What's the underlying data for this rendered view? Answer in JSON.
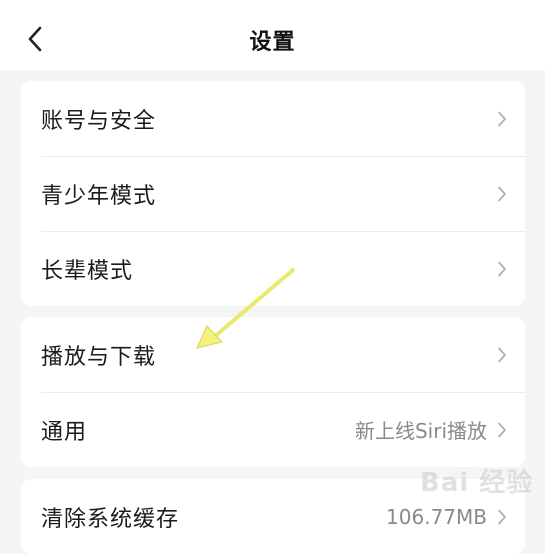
{
  "header": {
    "title": "设置",
    "back_icon": "chevron-left-icon"
  },
  "groups": [
    {
      "items": [
        {
          "label": "账号与安全",
          "value": ""
        },
        {
          "label": "青少年模式",
          "value": ""
        },
        {
          "label": "长辈模式",
          "value": ""
        }
      ]
    },
    {
      "items": [
        {
          "label": "播放与下载",
          "value": ""
        },
        {
          "label": "通用",
          "value": "新上线Siri播放"
        }
      ]
    },
    {
      "items": [
        {
          "label": "清除系统缓存",
          "value": "106.77MB"
        }
      ]
    }
  ],
  "annotation": {
    "color": "#f2f27a",
    "points_to": "播放与下载"
  },
  "watermark": {
    "text": "Bai 经验"
  },
  "colors": {
    "background": "#f4f5f7",
    "card": "#ffffff",
    "value_text": "#8a8a8a",
    "chevron": "#b0b0b0"
  }
}
